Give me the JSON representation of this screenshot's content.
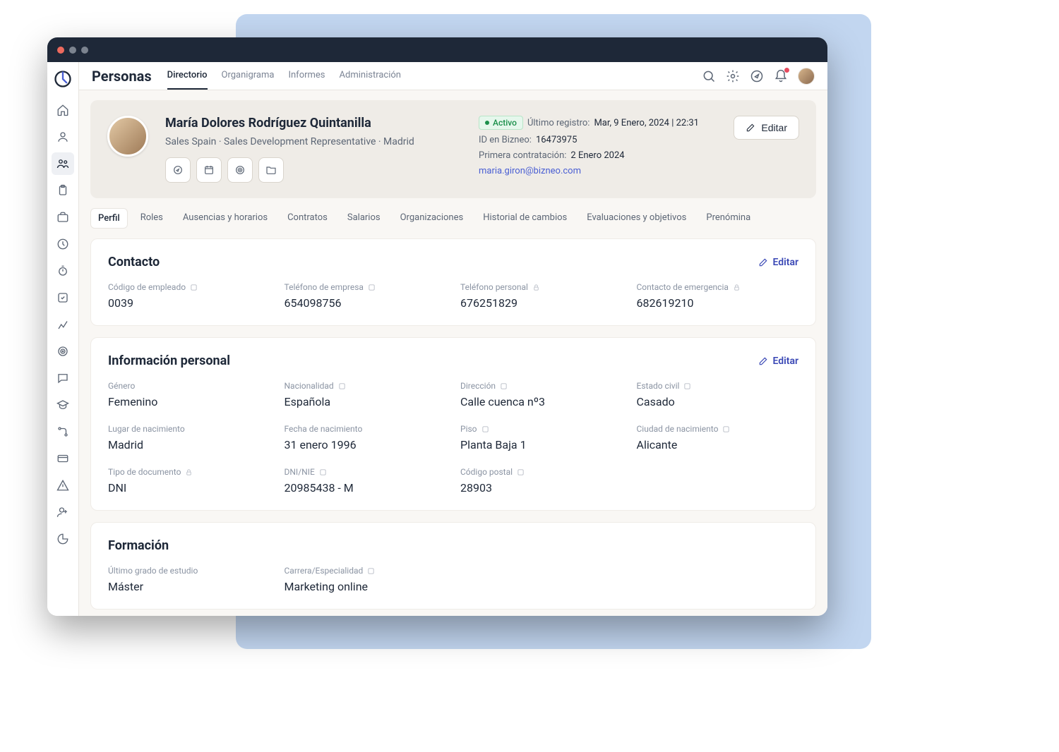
{
  "topbar": {
    "title": "Personas",
    "tabs": [
      "Directorio",
      "Organigrama",
      "Informes",
      "Administración"
    ],
    "active_tab": 0
  },
  "profile": {
    "name": "María Dolores Rodríguez Quintanilla",
    "subtitle": "Sales Spain · Sales Development Representative · Madrid",
    "status_label": "Activo",
    "last_login_label": "Último registro:",
    "last_login_value": "Mar, 9 Enero, 2024 | 22:31",
    "id_label": "ID en Bizneo:",
    "id_value": "16473975",
    "first_hire_label": "Primera contratación:",
    "first_hire_value": "2 Enero 2024",
    "email": "maria.giron@bizneo.com",
    "edit_button": "Editar"
  },
  "detail_tabs": [
    "Perfil",
    "Roles",
    "Ausencias y horarios",
    "Contratos",
    "Salarios",
    "Organizaciones",
    "Historial de cambios",
    "Evaluaciones y objetivos",
    "Prenómina"
  ],
  "detail_active_tab": 0,
  "edit_label": "Editar",
  "sections": {
    "contacto": {
      "title": "Contacto",
      "fields": [
        {
          "label": "Código de empleado",
          "value": "0039",
          "locked": false
        },
        {
          "label": "Teléfono de empresa",
          "value": "654098756",
          "locked": false
        },
        {
          "label": "Teléfono personal",
          "value": "676251829",
          "locked": true
        },
        {
          "label": "Contacto de emergencia",
          "value": "682619210",
          "locked": true
        }
      ]
    },
    "personal": {
      "title": "Información personal",
      "fields": [
        {
          "label": "Género",
          "value": "Femenino",
          "locked": false,
          "info": false
        },
        {
          "label": "Nacionalidad",
          "value": "Española",
          "locked": false,
          "info": true
        },
        {
          "label": "Dirección",
          "value": "Calle cuenca nº3",
          "locked": false,
          "info": true
        },
        {
          "label": "Estado civil",
          "value": "Casado",
          "locked": false,
          "info": true
        },
        {
          "label": "Lugar de nacimiento",
          "value": "Madrid",
          "locked": false,
          "info": false
        },
        {
          "label": "Fecha de nacimiento",
          "value": "31 enero 1996",
          "locked": false,
          "info": false
        },
        {
          "label": "Piso",
          "value": "Planta Baja 1",
          "locked": false,
          "info": true
        },
        {
          "label": "Ciudad de nacimiento",
          "value": "Alicante",
          "locked": false,
          "info": true
        },
        {
          "label": "Tipo de documento",
          "value": "DNI",
          "locked": true,
          "info": false
        },
        {
          "label": "DNI/NIE",
          "value": "20985438 - M",
          "locked": false,
          "info": true
        },
        {
          "label": "Código postal",
          "value": "28903",
          "locked": false,
          "info": true
        }
      ]
    },
    "formacion": {
      "title": "Formación",
      "fields": [
        {
          "label": "Último grado de estudio",
          "value": "Máster",
          "locked": false,
          "info": false
        },
        {
          "label": "Carrera/Especialidad",
          "value": "Marketing online",
          "locked": false,
          "info": true
        }
      ]
    }
  }
}
